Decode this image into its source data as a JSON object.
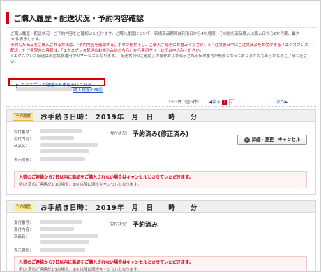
{
  "page_title": "ご購入履歴・配送状況・予約内容確認",
  "intro": {
    "line1": "ご購入履歴・配送状況・ご予約内容をご確認いただけます。ご購入履歴について、新規商品期間は利用日から4か月間、その他の商品購入は購入日から6か月間、最大",
    "line2": "30件表示します。",
    "line3": "予約した商品をご購入される方法は、「予約内容を確認する」ボタンを押下し、ご購入手続きにお進みください。※「注文後日中にご注文商品をお受けする「エクスプレス",
    "line4": "配送」をご希望のお客様は、「エクスプレス配送のお申込みはこちら」から専用サイトにてお申込みください。",
    "line5": "※エクスプレス配送は現在試験運用中のサービスとなります。「配送状況のご確認」の操作および表示される伝票番号が無効となっておりますのであらかじめご了承ください。"
  },
  "links": {
    "express": "エクスプレス配送のお申込みはこちら",
    "history_suffix": "購入履歴の確認"
  },
  "pagination": {
    "summary": "1〜3件（全5件）",
    "prev": "戻る",
    "pages": [
      "1",
      "2"
    ],
    "next": "次へ"
  },
  "orders": [
    {
      "tag": "予約履歴",
      "title": "お手続き日時：　2019年　月　日　　時　　分",
      "fields": [
        "受付番号：",
        "受付内容：",
        "商品名：",
        "",
        "表示期間："
      ],
      "status_label": "受付状況：",
      "status": "予約済み(修正済み)",
      "button": "詳細・変更・キャンセル",
      "notice1": "入荷のご連絡から7日以内に商品をご購入されない場合はキャンセルとさせていただきます。",
      "notice2": "例)入荷のご連絡が3/1の場合、3/9 以降に順次キャンセルとなります。"
    },
    {
      "tag": "予約履歴",
      "title": "お手続き日時：　2019年　月　日　　時　　分",
      "fields": [
        "受付番号：",
        "受付内容：",
        "商品名：",
        "",
        "表示期間："
      ],
      "status_label": "受付状況：",
      "status": "予約済み",
      "notice1": "入荷のご連絡から7日以内に商品をご購入されない場合はキャンセルとさせていただきます。",
      "notice2": "例)入荷のご連絡が3/1の場合、3/9 以降に順次キャンセルとなります。"
    }
  ],
  "colors": {
    "accent": "#d0021b",
    "link": "#2255aa",
    "highlight_box": "#d40000"
  }
}
